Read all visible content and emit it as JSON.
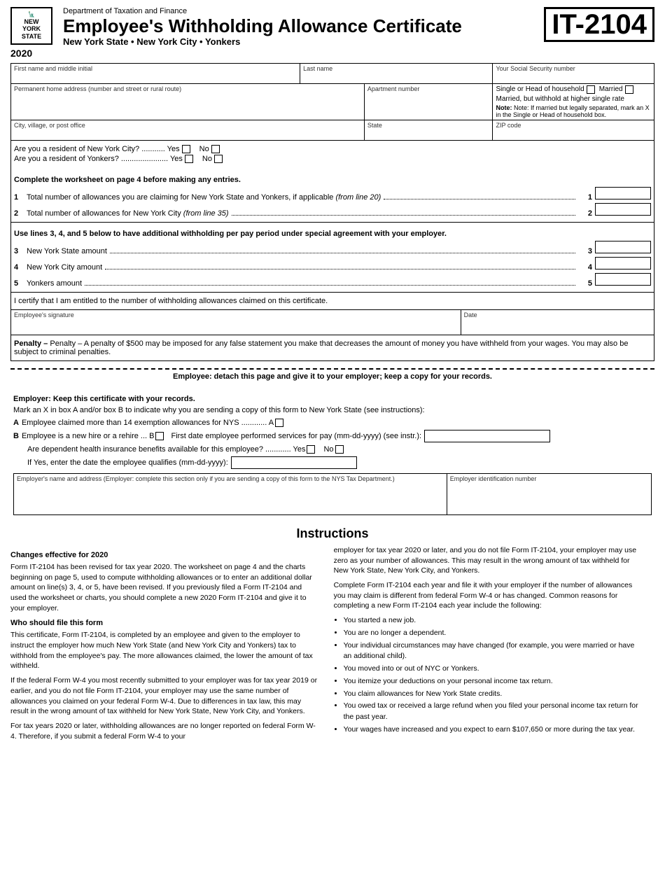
{
  "header": {
    "dept": "Department of Taxation and Finance",
    "title": "Employee's Withholding Allowance Certificate",
    "subtitle": "New York State • New York City • Yonkers",
    "form_number": "IT-2104",
    "year": "2020",
    "logo_line1": "NEW",
    "logo_line2": "YORK",
    "logo_line3": "STATE"
  },
  "form": {
    "field_labels": {
      "first_name": "First name and middle initial",
      "last_name": "Last name",
      "ssn": "Your Social Security number",
      "address": "Permanent home address (number and street or rural route)",
      "apt": "Apartment number",
      "city": "City, village, or post office",
      "state": "State",
      "zip": "ZIP code",
      "single_hoh": "Single or Head of household",
      "married": "Married",
      "married_higher": "Married, but withhold at higher single rate",
      "married_note": "Note: If married but legally separated, mark an X in the Single or Head of household box."
    },
    "residence": {
      "nyc_q": "Are you a resident of New York City? ........... Yes",
      "nyc_no": "No",
      "yonkers_q": "Are you a resident of Yonkers? ...................... Yes",
      "yonkers_no": "No"
    },
    "worksheet_instruction": "Complete the worksheet on page 4 before making any entries.",
    "line1_label": "Total number of allowances you are claiming for New York State and Yonkers, if applicable",
    "line1_italic": "(from line 20)",
    "line1_num": "1",
    "line2_label": "Total number of allowances for New York City",
    "line2_italic": "(from line 35)",
    "line2_num": "2",
    "special_instruction": "Use lines 3, 4, and 5 below to have additional withholding per pay period under special agreement with your employer.",
    "line3_label": "New York State amount",
    "line3_num": "3",
    "line4_label": "New York City amount",
    "line4_num": "4",
    "line5_label": "Yonkers amount",
    "line5_num": "5",
    "certify_text": "I certify that I am entitled to the number of withholding allowances claimed on this certificate.",
    "sig_label": "Employee's signature",
    "date_label": "Date",
    "penalty_text": "Penalty – A penalty of $500 may be imposed for any false statement you make that decreases the amount of money you have withheld from your wages. You may also be subject to criminal penalties.",
    "detach_text": "Employee: detach this page and give it to your employer; keep a copy for your records."
  },
  "employer_section": {
    "heading": "Employer: Keep this certificate with your records.",
    "instruction": "Mark an X in box A and/or box B to indicate why you are sending a copy of this form to New York State (see instructions):",
    "box_a_label": "Employee claimed more than 14 exemption allowances for NYS ............ A",
    "box_b_label": "Employee is a new hire or a rehire ... B",
    "first_date_label": "First date employee performed services for pay (mm-dd-yyyy) (see instr.):",
    "health_q": "Are dependent health insurance benefits available for this employee? ............ Yes",
    "health_no": "No",
    "if_yes_label": "If Yes, enter the date the employee qualifies (mm-dd-yyyy):",
    "employer_name_label": "Employer's name and address (Employer: complete this section only if you are sending a copy of this form to the NYS Tax Department.)",
    "ein_label": "Employer identification number"
  },
  "instructions": {
    "title": "Instructions",
    "changes_heading": "Changes effective for 2020",
    "changes_text1": "Form IT-2104 has been revised for tax year 2020. The worksheet on page 4 and the charts beginning on page 5, used to compute withholding allowances or to enter an additional dollar amount on line(s) 3, 4, or 5, have been revised. If you previously filed a Form IT-2104 and used the worksheet or charts, you should complete a new 2020 Form IT-2104 and give it to your employer.",
    "who_heading": "Who should file this form",
    "who_text1": "This certificate, Form IT-2104, is completed by an employee and given to the employer to instruct the employer how much New York State (and New York City and Yonkers) tax to withhold from the employee's pay. The more allowances claimed, the lower the amount of tax withheld.",
    "who_text2": "If the federal Form W-4 you most recently submitted to your employer was for tax year 2019 or earlier, and you do not file Form IT-2104, your employer may use the same number of allowances you claimed on your federal Form W-4. Due to differences in tax law, this may result in the wrong amount of tax withheld for New York State, New York City, and Yonkers.",
    "who_text3": "For tax years 2020 or later, withholding allowances are no longer reported on federal Form W-4. Therefore, if you submit a federal Form W-4 to your",
    "right_col_text1": "employer for tax year 2020 or later, and you do not file Form IT-2104, your employer may use zero as your number of allowances. This may result in the wrong amount of tax withheld for New York State, New York City, and Yonkers.",
    "right_col_text2": "Complete Form IT-2104 each year and file it with your employer if the number of allowances you may claim is different from federal Form W-4 or has changed. Common reasons for completing a new Form IT-2104 each year include the following:",
    "bullets": [
      "You started a new job.",
      "You are no longer a dependent.",
      "Your individual circumstances may have changed (for example, you were married or have an additional child).",
      "You moved into or out of NYC or Yonkers.",
      "You itemize your deductions on your personal income tax return.",
      "You claim allowances for New York State credits.",
      "You owed tax or received a large refund when you filed your personal income tax return for the past year.",
      "Your wages have increased and you expect to earn $107,650 or more during the tax year."
    ]
  }
}
